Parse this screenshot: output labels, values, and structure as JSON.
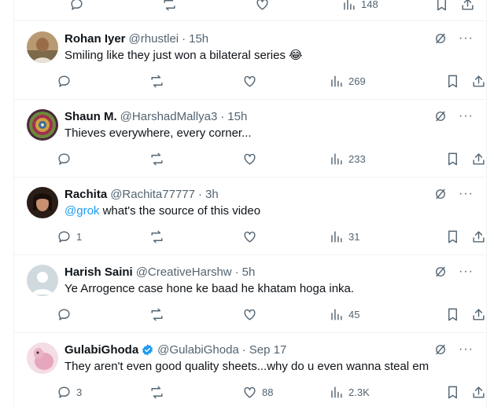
{
  "top_actions": {
    "views": "148"
  },
  "tweets": [
    {
      "name": "Rohan Iyer",
      "handle": "@rhustlei",
      "time": "15h",
      "text": "Smiling like they just won a bilateral series 😂",
      "replies": "",
      "retweets": "",
      "likes": "",
      "views": "269",
      "avatar": "avatar-photo-man"
    },
    {
      "name": "Shaun M.",
      "handle": "@HarshadMallya3",
      "time": "15h",
      "text": "Thieves everywhere, every corner...",
      "replies": "",
      "retweets": "",
      "likes": "",
      "views": "233",
      "avatar": "avatar-mandala"
    },
    {
      "name": "Rachita",
      "handle": "@Rachita77777",
      "time": "3h",
      "mention": "@grok",
      "text": " what's the source of this video",
      "replies": "1",
      "retweets": "",
      "likes": "",
      "views": "31",
      "avatar": "avatar-photo-woman"
    },
    {
      "name": "Harish Saini",
      "handle": "@CreativeHarshw",
      "time": "5h",
      "text": "Ye Arrogence case hone ke baad he khatam hoga inka.",
      "replies": "",
      "retweets": "",
      "likes": "",
      "views": "45",
      "avatar": "avatar-default"
    },
    {
      "name": "GulabiGhoda",
      "handle": "@GulabiGhoda",
      "time": "Sep 17",
      "verified": true,
      "text": "They aren't even good quality sheets...why do u even wanna steal em",
      "replies": "3",
      "retweets": "",
      "likes": "88",
      "views": "2.3K",
      "avatar": "avatar-pink-horse"
    }
  ],
  "separator": "·",
  "more_label": "···",
  "colors": {
    "link": "#1d9bf0",
    "secondary": "#536471",
    "verified": "#1d9bf0"
  }
}
